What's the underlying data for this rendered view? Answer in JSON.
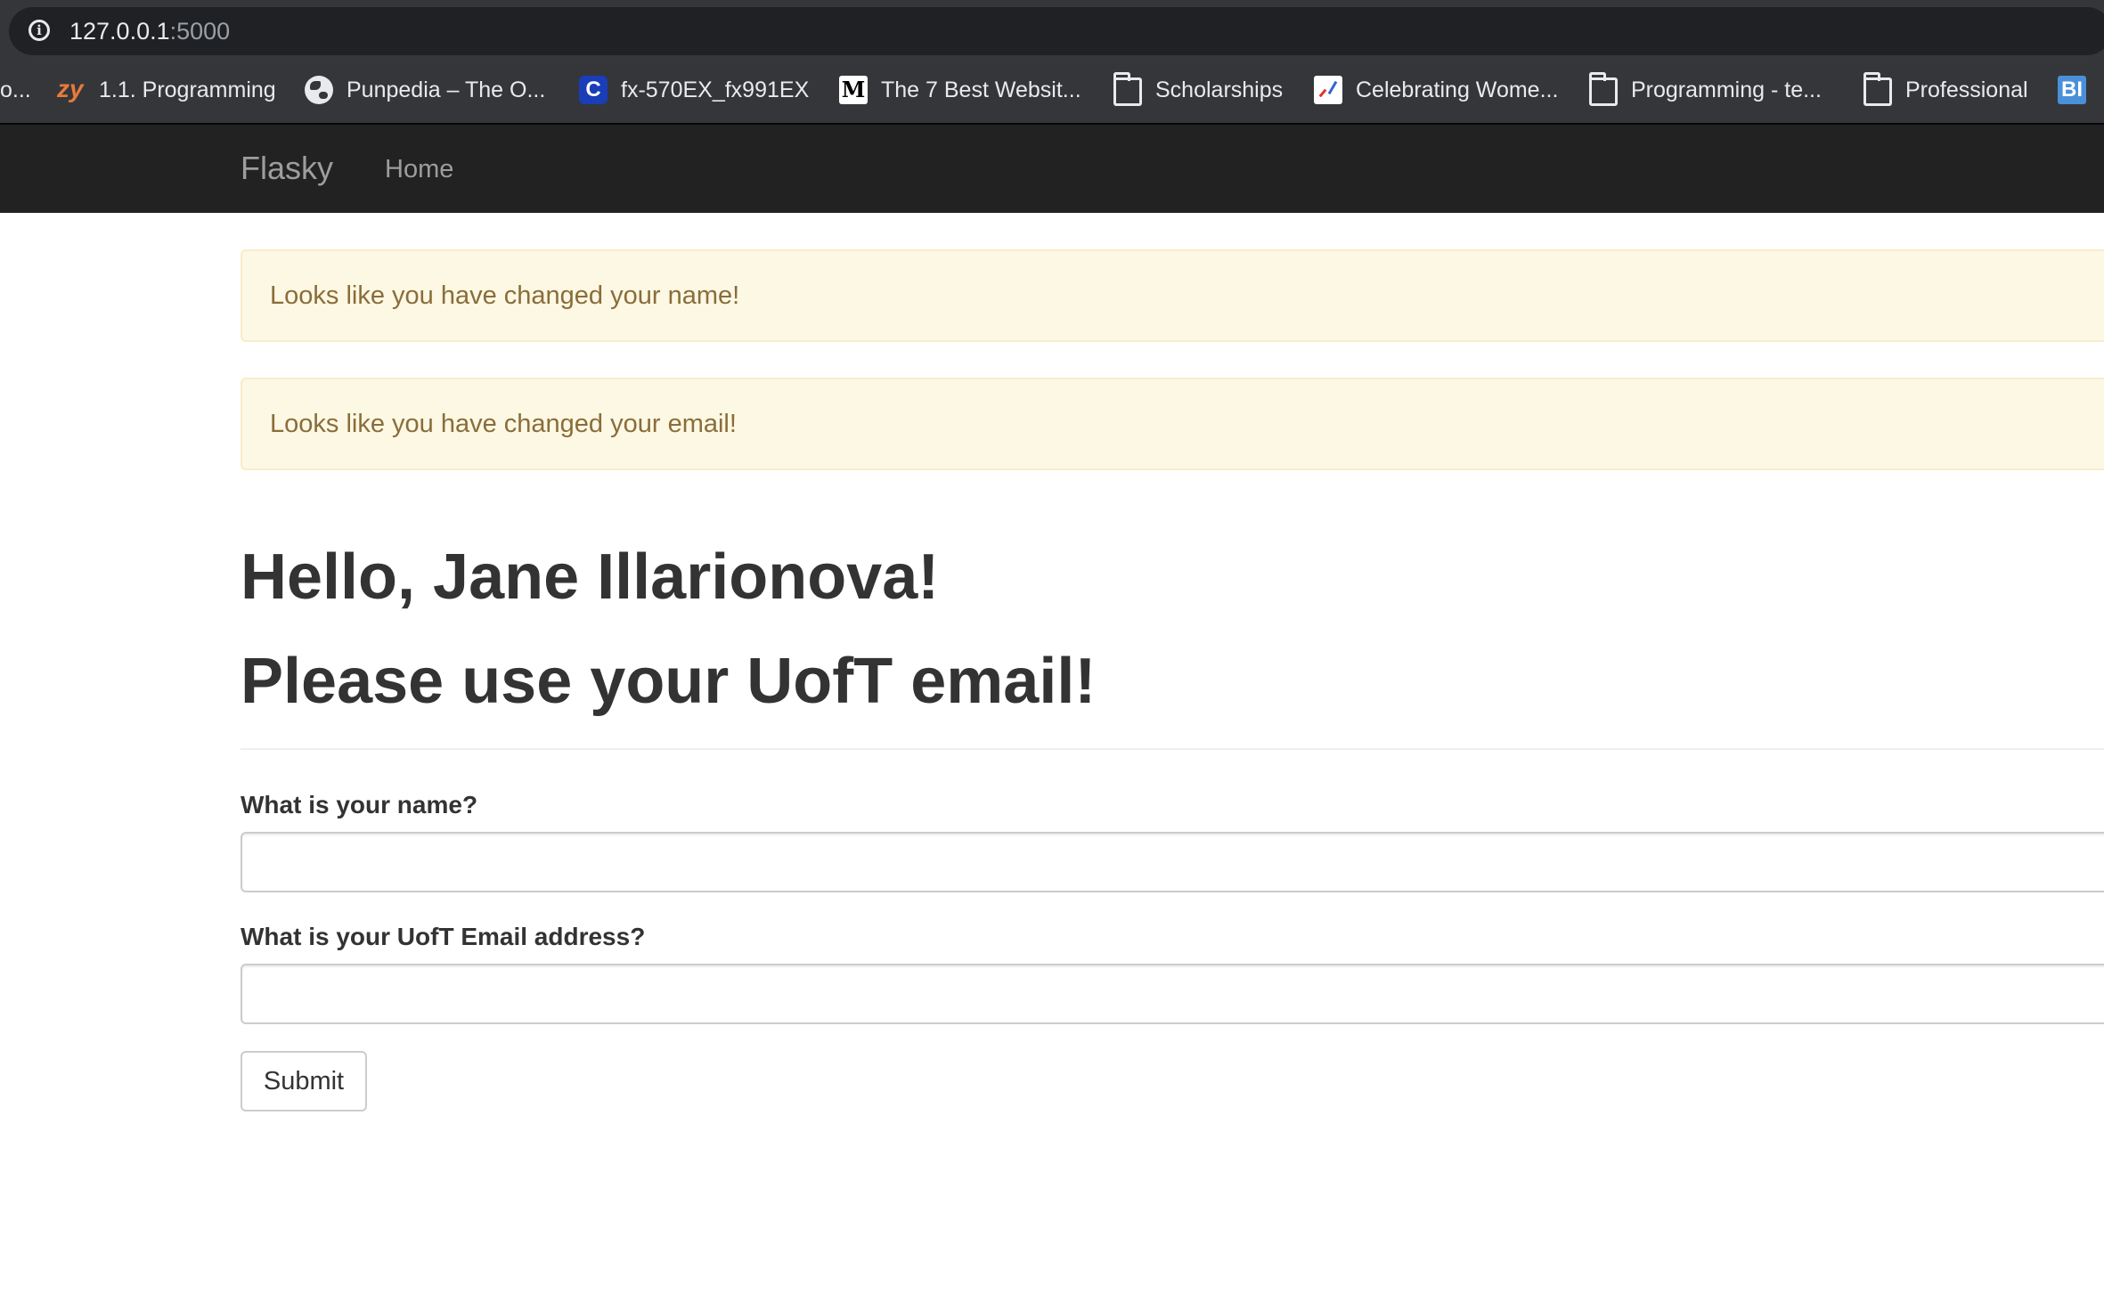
{
  "browser": {
    "url_host": "127.0.0.1",
    "url_port": ":5000",
    "bookmarks": [
      {
        "label": "o...",
        "icon": "none"
      },
      {
        "label": "1.1. Programming",
        "icon": "zybooks-icon"
      },
      {
        "label": "Punpedia – The O...",
        "icon": "globe-icon"
      },
      {
        "label": "fx-570EX_fx991EX",
        "icon": "c-logo-icon"
      },
      {
        "label": "The 7 Best Websit...",
        "icon": "medium-icon"
      },
      {
        "label": "Scholarships",
        "icon": "folder-icon"
      },
      {
        "label": "Celebrating Wome...",
        "icon": "chart-icon"
      },
      {
        "label": "Programming - te...",
        "icon": "folder-icon"
      },
      {
        "label": "Professional",
        "icon": "folder-icon"
      },
      {
        "label": "",
        "icon": "bi-icon"
      }
    ]
  },
  "navbar": {
    "brand": "Flasky",
    "home_label": "Home"
  },
  "alerts": [
    "Looks like you have changed your name!",
    "Looks like you have changed your email!"
  ],
  "page": {
    "greeting": "Hello, Jane Illarionova!",
    "subheading": "Please use your UofT email!"
  },
  "form": {
    "name_label": "What is your name?",
    "name_value": "",
    "email_label": "What is your UofT Email address?",
    "email_value": "",
    "submit_label": "Submit"
  },
  "colors": {
    "chrome_bg": "#35363a",
    "navbar_bg": "#222222",
    "alert_bg": "#fcf8e3",
    "alert_text": "#8a6d3b",
    "heading_text": "#333333"
  }
}
